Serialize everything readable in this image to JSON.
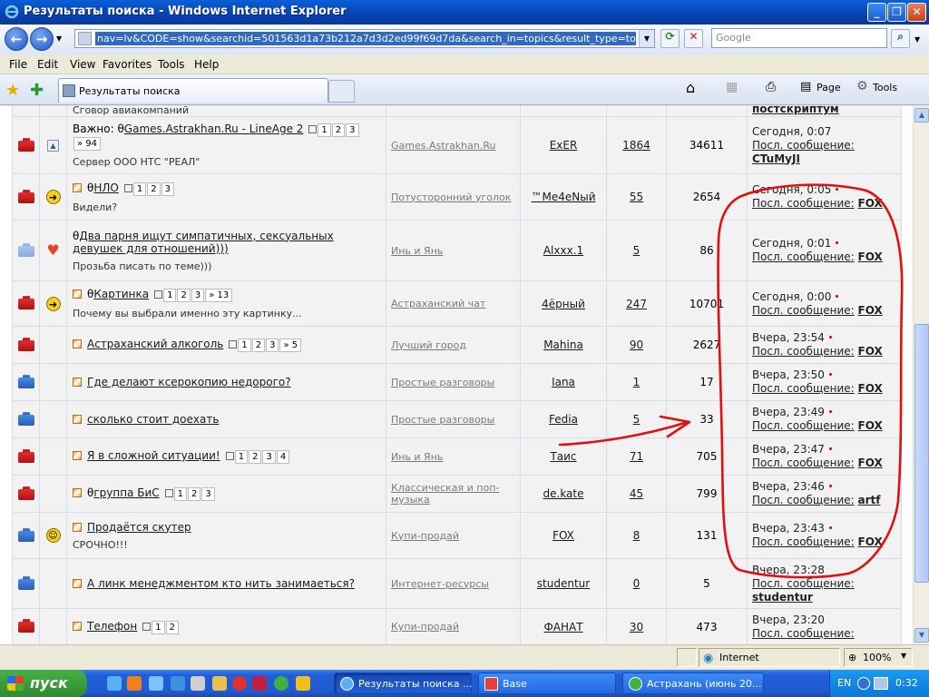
{
  "window": {
    "title": "Результаты поиска - Windows Internet Explorer"
  },
  "address": {
    "url": "nav=lv&CODE=show&searchid=501563d1a73b212a7d3d2ed99f69d7da&search_in=topics&result_type=topics&lastdate=0"
  },
  "search": {
    "placeholder": "Google"
  },
  "menu": [
    "File",
    "Edit",
    "View",
    "Favorites",
    "Tools",
    "Help"
  ],
  "tab": {
    "label": "Результаты поиска"
  },
  "toolbar": {
    "page": "Page",
    "tools": "Tools"
  },
  "top_partial": {
    "desc": "Сговор авиакомпаний",
    "last_author": "постскриптум"
  },
  "rows": [
    {
      "folder": "red",
      "icon": "up",
      "prefix": "Важно: ",
      "bolt": true,
      "title": "Games.Astrakhan.Ru - LineAge 2",
      "pages": [
        "1",
        "2",
        "3",
        "» 94"
      ],
      "desc": "Сервер ООО НТС \"РЕАЛ\"",
      "forum": "Games.Astrakhan.Ru",
      "author": "ExER",
      "replies": "1864",
      "views": "34611",
      "last_time": "Сегодня, 0:07",
      "last_by": "CTuMyJI",
      "newdot": false,
      "mini": false,
      "h": 63
    },
    {
      "folder": "red",
      "icon": "arrow",
      "prefix": "",
      "bolt": true,
      "title": "НЛО",
      "pages": [
        "1",
        "2",
        "3"
      ],
      "desc": "Видели?",
      "forum": "Потусторонний уголок",
      "author": "™Me4eNый",
      "replies": "55",
      "views": "2654",
      "last_time": "Сегодня, 0:05",
      "last_by": "FOX",
      "newdot": true,
      "mini": true,
      "h": 51
    },
    {
      "folder": "pale",
      "icon": "heart",
      "prefix": "",
      "bolt": true,
      "title": "Два парня ищут симпатичных, сексуальных девушек для отношений)))",
      "pages": [],
      "desc": "Прозьба писать по теме)))",
      "forum": "Инь и Янь",
      "author": "Alxxx.1",
      "replies": "5",
      "views": "86",
      "last_time": "Сегодня, 0:01",
      "last_by": "FOX",
      "newdot": true,
      "mini": false,
      "h": 67
    },
    {
      "folder": "red",
      "icon": "arrow",
      "prefix": "",
      "bolt": true,
      "title": "Картинка",
      "pages": [
        "1",
        "2",
        "3",
        "» 13"
      ],
      "desc": "Почему вы выбрали именно эту картинку...",
      "forum": "Астраханский чат",
      "author": "4ёрный",
      "replies": "247",
      "views": "10701",
      "last_time": "Сегодня, 0:00",
      "last_by": "FOX",
      "newdot": true,
      "mini": true,
      "h": 50
    },
    {
      "folder": "red",
      "icon": "",
      "prefix": "",
      "bolt": false,
      "title": "Астраханский алкоголь",
      "pages": [
        "1",
        "2",
        "3",
        "» 5"
      ],
      "desc": "",
      "forum": "Лучший город",
      "author": "Mahina",
      "replies": "90",
      "views": "2627",
      "last_time": "Вчера, 23:54",
      "last_by": "FOX",
      "newdot": true,
      "mini": true,
      "h": 41
    },
    {
      "folder": "blue",
      "icon": "",
      "prefix": "",
      "bolt": false,
      "title": "Где делают ксерокопию недорого?",
      "pages": [],
      "desc": "",
      "forum": "Простые разговоры",
      "author": "Iana",
      "replies": "1",
      "views": "17",
      "last_time": "Вчера, 23:50",
      "last_by": "FOX",
      "newdot": true,
      "mini": true,
      "h": 41
    },
    {
      "folder": "blue",
      "icon": "",
      "prefix": "",
      "bolt": false,
      "title": "сколько стоит доехать",
      "pages": [],
      "desc": "",
      "forum": "Простые разговоры",
      "author": "Fedia",
      "replies": "5",
      "views": "33",
      "last_time": "Вчера, 23:49",
      "last_by": "FOX",
      "newdot": true,
      "mini": true,
      "h": 41
    },
    {
      "folder": "red",
      "icon": "",
      "prefix": "",
      "bolt": false,
      "title": "Я в сложной ситуации!",
      "pages": [
        "1",
        "2",
        "3",
        "4"
      ],
      "desc": "",
      "forum": "Инь и Янь",
      "author": "Таис",
      "replies": "71",
      "views": "705",
      "last_time": "Вчера, 23:47",
      "last_by": "FOX",
      "newdot": true,
      "mini": true,
      "h": 41
    },
    {
      "folder": "red",
      "icon": "",
      "prefix": "",
      "bolt": true,
      "title": "группа БиС",
      "pages": [
        "1",
        "2",
        "3"
      ],
      "desc": "",
      "forum": "Классическая и поп-музыка",
      "author": "de.kate",
      "replies": "45",
      "views": "799",
      "last_time": "Вчера, 23:46",
      "last_by": "artf",
      "newdot": true,
      "mini": true,
      "h": 41
    },
    {
      "folder": "blue",
      "icon": "smile",
      "prefix": "",
      "bolt": false,
      "title": "Продаётся скутер",
      "pages": [],
      "desc": "СРОЧНО!!!",
      "forum": "Купи-продай",
      "author": "FOX",
      "replies": "8",
      "views": "131",
      "last_time": "Вчера, 23:43",
      "last_by": "FOX",
      "newdot": true,
      "mini": true,
      "h": 51
    },
    {
      "folder": "blue",
      "icon": "",
      "prefix": "",
      "bolt": false,
      "title": "А линк менеджментом кто нить занимаеться?",
      "pages": [],
      "desc": "",
      "forum": "Интернет-ресурсы",
      "author": "studentur",
      "replies": "0",
      "views": "5",
      "last_time": "Вчера, 23:28",
      "last_by": "studentur",
      "newdot": false,
      "mini": true,
      "h": 55
    },
    {
      "folder": "red",
      "icon": "",
      "prefix": "",
      "bolt": false,
      "title": "Телефон",
      "pages": [
        "1",
        "2"
      ],
      "desc": "",
      "forum": "Купи-продай",
      "author": "ФАНАТ",
      "replies": "30",
      "views": "473",
      "last_time": "Вчера, 23:20",
      "last_by": "",
      "newdot": false,
      "mini": true,
      "h": 40
    }
  ],
  "last_label": "Посл. сообщение:",
  "status": {
    "zone": "Internet",
    "zoom": "100%"
  },
  "taskbar": {
    "start": "пуск",
    "tasks": [
      "Результаты поиска ...",
      "Base",
      "Астрахань (июнь 20..."
    ],
    "lang": "EN",
    "clock": "0:32"
  },
  "colors": {
    "title_bar": "#0a5fd8",
    "annotation": "#e01010",
    "folder_red": "#d02020",
    "folder_blue": "#3a78d0"
  }
}
